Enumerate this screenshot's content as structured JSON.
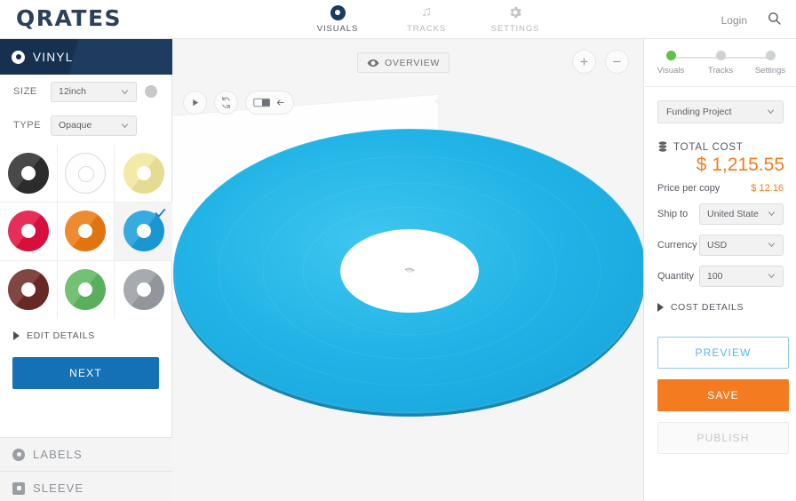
{
  "header": {
    "logo": "QRATES",
    "nav": [
      {
        "label": "VISUALS",
        "icon": "vinyl-ring-icon",
        "active": true
      },
      {
        "label": "TRACKS",
        "icon": "music-note-icon",
        "active": false
      },
      {
        "label": "SETTINGS",
        "icon": "gear-icon",
        "active": false
      }
    ],
    "login_label": "Login",
    "search_icon": "search-icon"
  },
  "sidebar": {
    "vinyl": {
      "title": "VINYL",
      "icon": "vinyl-ring-icon",
      "size_label": "SIZE",
      "size_value": "12inch",
      "type_label": "TYPE",
      "type_value": "Opaque",
      "swatches": [
        {
          "name": "black",
          "color": "#2e2e2e",
          "selected": false
        },
        {
          "name": "clear",
          "color": "#fdfdfd",
          "selected": false
        },
        {
          "name": "pale-yellow",
          "color": "#f2e79a",
          "selected": false
        },
        {
          "name": "crimson",
          "color": "#e2103f",
          "selected": false
        },
        {
          "name": "orange",
          "color": "#ec7a11",
          "selected": false
        },
        {
          "name": "blue",
          "color": "#1b9ede",
          "selected": true
        },
        {
          "name": "dark-red",
          "color": "#6e2a26",
          "selected": false
        },
        {
          "name": "green",
          "color": "#5eb860",
          "selected": false
        },
        {
          "name": "gray",
          "color": "#9a9ea3",
          "selected": false
        }
      ],
      "edit_details_label": "EDIT DETAILS",
      "next_label": "NEXT"
    },
    "sections": [
      {
        "label": "LABELS",
        "icon": "circle-label-icon"
      },
      {
        "label": "SLEEVE",
        "icon": "square-sleeve-icon"
      }
    ]
  },
  "canvas": {
    "tools": [
      {
        "name": "play-button",
        "icon": "play-icon"
      },
      {
        "name": "rotate-button",
        "icon": "rotate-arrows-icon"
      },
      {
        "name": "flip-side-button",
        "icon": "flip-side-icon"
      }
    ],
    "overview_label": "OVERVIEW",
    "overview_icon": "eye-icon",
    "zoom_in_label": "+",
    "zoom_out_label": "−",
    "record_color": "#1fb6e8",
    "label_color": "#ffffff",
    "sleeve_color": "#ffffff",
    "background_color": "#f5f5f6"
  },
  "right": {
    "steps": [
      {
        "label": "Visuals",
        "done": true
      },
      {
        "label": "Tracks",
        "done": false
      },
      {
        "label": "Settings",
        "done": false
      }
    ],
    "project_type": "Funding Project",
    "total_cost_label": "TOTAL COST",
    "total_cost_value": "$ 1,215.55",
    "price_per_copy_label": "Price per copy",
    "price_per_copy_value": "$ 12.16",
    "fields": [
      {
        "label": "Ship to",
        "value": "United State"
      },
      {
        "label": "Currency",
        "value": "USD"
      },
      {
        "label": "Quantity",
        "value": "100"
      }
    ],
    "cost_details_label": "COST DETAILS",
    "buttons": {
      "preview": "PREVIEW",
      "save": "SAVE",
      "publish": "PUBLISH"
    },
    "accent_orange": "#f47b20",
    "accent_blue": "#59b7ea",
    "accent_green": "#61c24a"
  }
}
